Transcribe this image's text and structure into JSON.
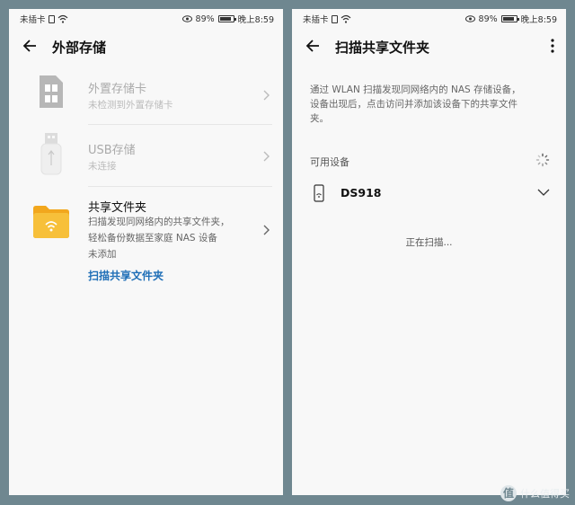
{
  "left": {
    "status": {
      "carrier": "未插卡",
      "battery": "89%",
      "time": "晚上8:59"
    },
    "title": "外部存储",
    "items": [
      {
        "title": "外置存储卡",
        "subtitle": "未检测到外置存储卡"
      },
      {
        "title": "USB存储",
        "subtitle": "未连接"
      },
      {
        "title": "共享文件夹",
        "subtitle_lines": [
          "扫描发现同网络内的共享文件夹，",
          "轻松备份数据至家庭 NAS 设备",
          "未添加"
        ],
        "link": "扫描共享文件夹"
      }
    ]
  },
  "right": {
    "status": {
      "carrier": "未插卡",
      "battery": "89%",
      "time": "晚上8:59"
    },
    "title": "扫描共享文件夹",
    "description_lines": [
      "通过 WLAN 扫描发现同网络内的 NAS 存储设备，",
      "设备出现后，点击访问并添加该设备下的共享文件",
      "夹。"
    ],
    "section_label": "可用设备",
    "device": {
      "name": "DS918"
    },
    "scanning_text": "正在扫描..."
  },
  "watermark": {
    "badge": "值",
    "text": "什么值得买"
  },
  "colors": {
    "background": "#6f8790",
    "panel": "#f8f8f8",
    "link": "#1f6fb7",
    "folder": "#f7b928"
  }
}
